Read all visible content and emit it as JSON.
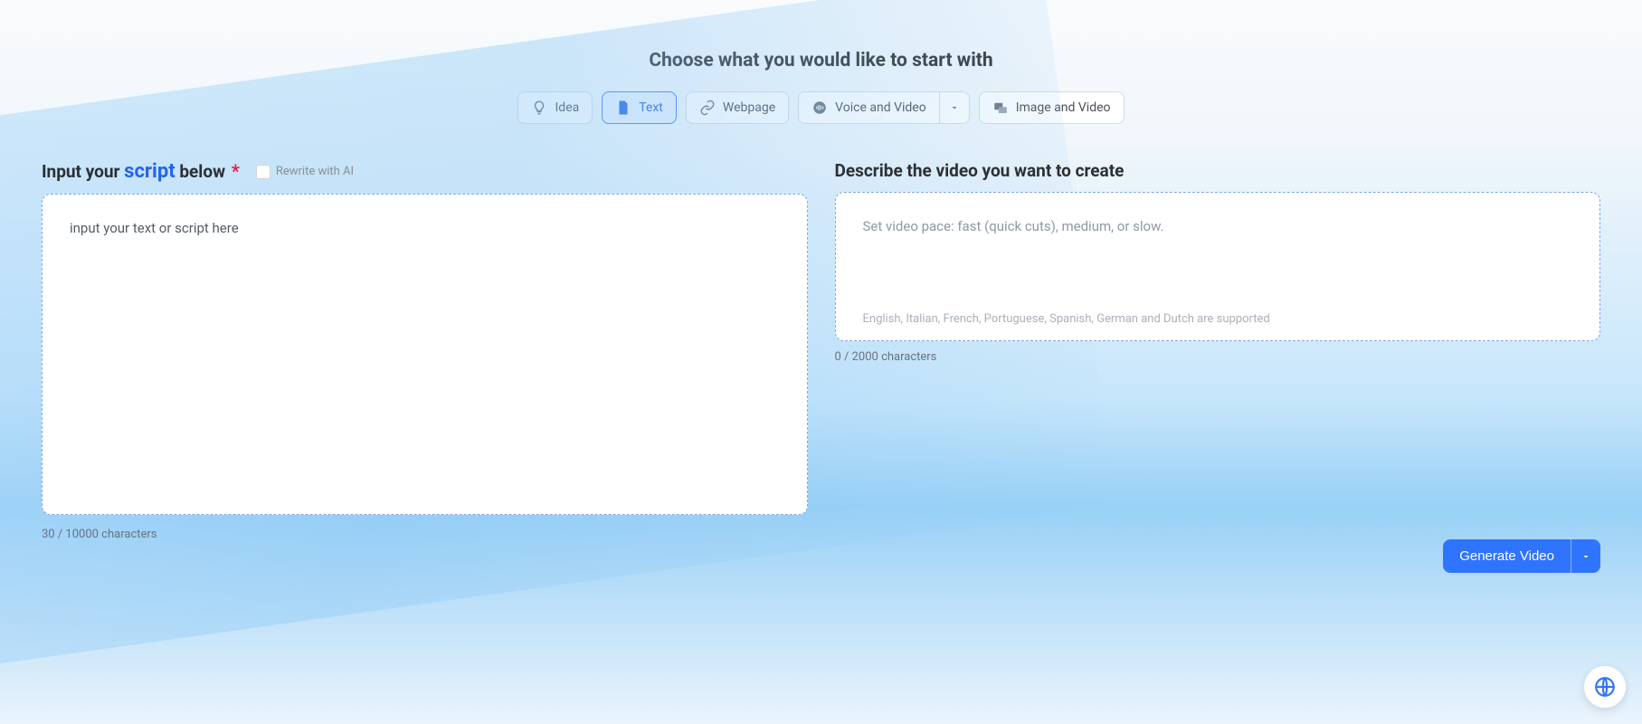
{
  "header": {
    "title": "Choose what you would like to start with",
    "tabs": [
      {
        "label": "Idea"
      },
      {
        "label": "Text"
      },
      {
        "label": "Webpage"
      },
      {
        "label": "Voice and Video"
      },
      {
        "label": "Image and Video"
      }
    ]
  },
  "left": {
    "heading_pre": "Input your ",
    "heading_script": "script",
    "heading_post": " below ",
    "star": "*",
    "rewrite_label": "Rewrite with AI",
    "placeholder": "input your text or script here",
    "value": "input your text or script here",
    "counter": "30 / 10000 characters"
  },
  "right": {
    "heading": "Describe the video you want to create",
    "placeholder": "Set video pace: fast (quick cuts), medium, or slow.",
    "hint": "English, Italian, French, Portuguese, Spanish, German and Dutch are supported",
    "counter": "0 / 2000 characters"
  },
  "generate_label": "Generate Video"
}
